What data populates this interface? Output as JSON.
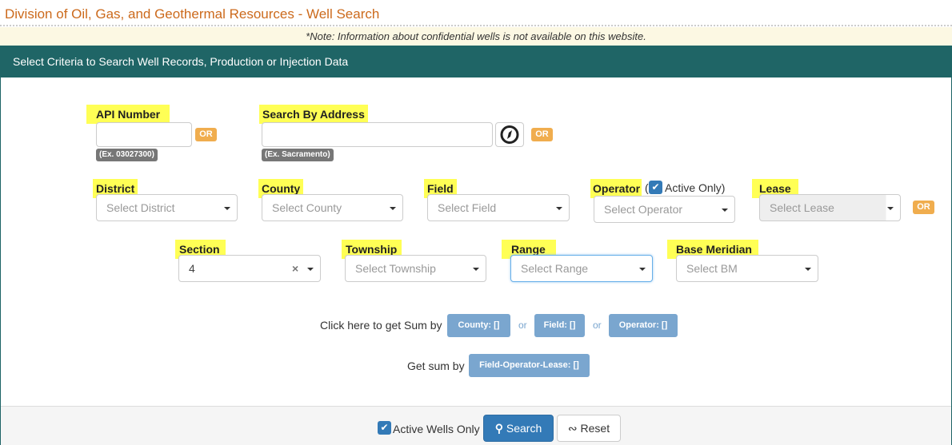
{
  "title": "Division of Oil, Gas, and Geothermal Resources - Well Search",
  "note": "*Note: Information about confidential wells is not available on this website.",
  "panel_title": "Select Criteria to Search Well Records, Production or Injection Data",
  "api": {
    "label": "API Number",
    "value": "",
    "example": "(Ex. 03027300)",
    "or": "OR"
  },
  "address": {
    "label": "Search By Address",
    "value": "",
    "example": "(Ex. Sacramento)",
    "or": "OR",
    "locate_icon": "compass-icon"
  },
  "district": {
    "label": "District",
    "placeholder": "Select District"
  },
  "county": {
    "label": "County",
    "placeholder": "Select County"
  },
  "field": {
    "label": "Field",
    "placeholder": "Select Field"
  },
  "operator": {
    "label": "Operator",
    "paren_open": "(",
    "active_only": "Active Only)",
    "active_checked": true,
    "placeholder": "Select Operator"
  },
  "lease": {
    "label": "Lease",
    "placeholder": "Select Lease",
    "or": "OR",
    "disabled": true
  },
  "section": {
    "label": "Section",
    "value": "4",
    "clear": "×"
  },
  "township": {
    "label": "Township",
    "placeholder": "Select Township"
  },
  "range": {
    "label": "Range",
    "placeholder": "Select Range"
  },
  "base_meridian": {
    "label": "Base Meridian",
    "placeholder": "Select BM"
  },
  "sum": {
    "prompt": "Click here to get Sum by",
    "county": "County:  []",
    "or1": "or",
    "field": "Field: []",
    "or2": "or",
    "operator": "Operator: []",
    "prompt2": "Get sum by",
    "fol": "Field-Operator-Lease: []"
  },
  "footer": {
    "active_wells": "Active Wells Only",
    "active_checked": true,
    "search": "Search",
    "reset": "Reset"
  },
  "colors": {
    "header": "#1f6566",
    "title": "#cc6a1c",
    "highlight": "#ffff55",
    "primary": "#337ab7",
    "or_badge": "#f0ad4e",
    "sum_button": "#7aa6cf"
  }
}
